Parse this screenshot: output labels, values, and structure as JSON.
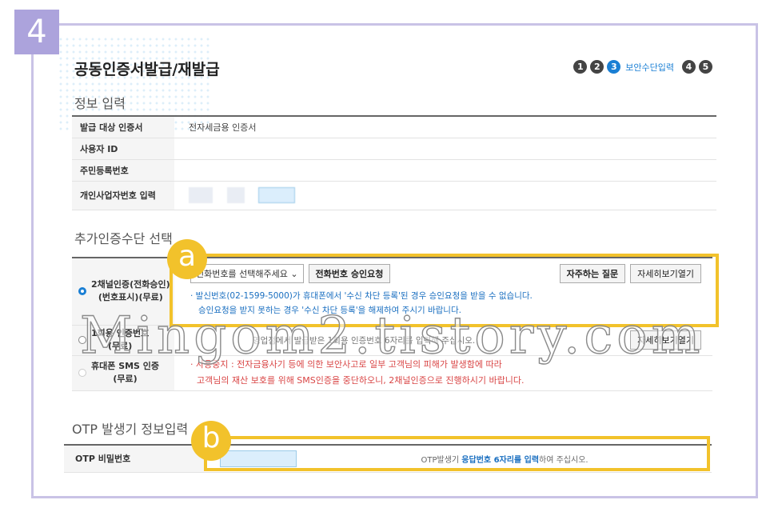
{
  "step_badge": "4",
  "title": "공동인증서발급/재발급",
  "steps": {
    "s1": "1",
    "s2": "2",
    "s3": "3",
    "s3_label": "보안수단입력",
    "s4": "4",
    "s5": "5"
  },
  "info": {
    "title": "정보 입력",
    "rows": [
      {
        "label": "발급 대상 인증서",
        "value": "전자세금용 인증서"
      },
      {
        "label": "사용자 ID",
        "value": ""
      },
      {
        "label": "주민등록번호",
        "value": ""
      },
      {
        "label": "개인사업자번호 입력",
        "value": ""
      }
    ]
  },
  "auth": {
    "title": "추가인증수단 선택",
    "option1": {
      "label_line1": "2채널인증(전화승인)",
      "label_line2": "(번호표시)(무료)",
      "select": "전화번호를 선택해주세요",
      "request_btn": "전화번호 승인요청",
      "faq_btn": "자주하는 질문",
      "detail_btn": "자세히보기열기",
      "note1": "· 발신번호(02-1599-5000)가 휴대폰에서 '수신 차단 등록'된 경우 승인요청을 받을 수 없습니다.",
      "note2": "승인요청을 받지 못하는 경우 '수신 차단 등록'을 해제하여 주시기 바랍니다."
    },
    "option2": {
      "label_line1": "1회용 인증번호",
      "label_line2": "(무료)",
      "note": "영업점에서 발급받은 1회용 인증번호 6자리를 입력해 주십시오.",
      "detail_btn": "자세히보기열기"
    },
    "option3": {
      "label_line1": "휴대폰 SMS 인증",
      "label_line2": "(무료)",
      "note1": "· 사용중지 : 전자금융사기 등에 의한 보안사고로 일부 고객님의 피해가 발생함에 따라",
      "note2": "고객님의 재산 보호를 위해 SMS인증을 중단하오니, 2채널인증으로 진행하시기 바랍니다."
    }
  },
  "otp": {
    "title": "OTP 발생기 정보입력",
    "label": "OTP 비밀번호",
    "msg_prefix": "OTP발생기 ",
    "msg_highlight": "응답번호 6자리를 입력",
    "msg_suffix": "하여 주십시오."
  },
  "markers": {
    "a": "a",
    "b": "b"
  },
  "watermark": "Mingom2.tistory.com",
  "colors": {
    "accent": "#1a7fd4",
    "highlight": "#f2c22b",
    "frame": "#c9c3e6",
    "badge": "#aca3dc"
  }
}
